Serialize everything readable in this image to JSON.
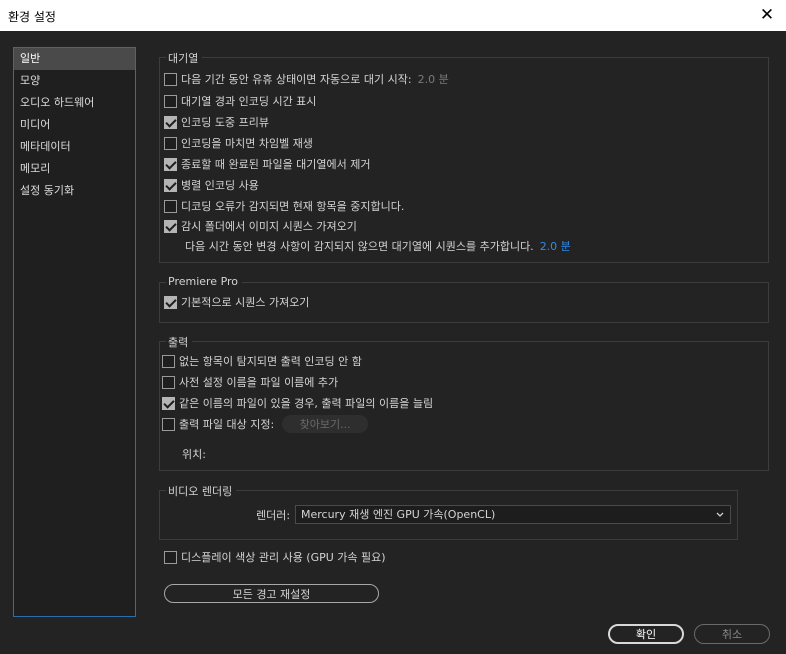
{
  "window": {
    "title": "환경 설정",
    "close_glyph": "✕"
  },
  "sidebar": {
    "items": [
      {
        "label": "일반"
      },
      {
        "label": "모양"
      },
      {
        "label": "오디오 하드웨어"
      },
      {
        "label": "미디어"
      },
      {
        "label": "메타데이터"
      },
      {
        "label": "메모리"
      },
      {
        "label": "설정 동기화"
      }
    ]
  },
  "queue": {
    "title": "대기열",
    "options": [
      {
        "label": "다음 기간 동안 유휴 상태이면 자동으로 대기 시작:",
        "checked": false,
        "suffix": "2.0 분"
      },
      {
        "label": "대기열 경과 인코딩 시간 표시",
        "checked": false
      },
      {
        "label": "인코딩 도중 프리뷰",
        "checked": true
      },
      {
        "label": "인코딩을 마치면 차임벨 재생",
        "checked": false
      },
      {
        "label": "종료할 때 완료된 파일을 대기열에서 제거",
        "checked": true
      },
      {
        "label": "병렬 인코딩 사용",
        "checked": true
      },
      {
        "label": "디코딩 오류가 감지되면 현재 항목을 중지합니다.",
        "checked": false
      },
      {
        "label": "감시 폴더에서 이미지 시퀀스 가져오기",
        "checked": true
      }
    ],
    "sub_text": "다음 시간 동안 변경 사항이 감지되지 않으면 대기열에 시퀀스를 추가합니다.",
    "sub_value": "2.0 분"
  },
  "premiere": {
    "title": "Premiere Pro",
    "options": [
      {
        "label": "기본적으로 시퀀스 가져오기",
        "checked": true
      }
    ]
  },
  "output": {
    "title": "출력",
    "options": [
      {
        "label": "없는 항목이 탐지되면 출력 인코딩 안 함",
        "checked": false
      },
      {
        "label": "사전 설정 이름을 파일 이름에 추가",
        "checked": false
      },
      {
        "label": "같은 이름의 파일이 있을 경우, 출력 파일의 이름을 늘림",
        "checked": true
      },
      {
        "label": "출력 파일 대상 지정:",
        "checked": false
      }
    ],
    "browse_label": "찾아보기...",
    "location_label": "위치:"
  },
  "video": {
    "title": "비디오 렌더링",
    "renderer_label": "렌더러:",
    "renderer_value": "Mercury 재생 엔진 GPU 가속(OpenCL)"
  },
  "display_color": {
    "label": "디스플레이 색상 관리 사용 (GPU 가속 필요)",
    "checked": false
  },
  "reset_label": "모든 경고 재설정",
  "footer": {
    "ok_label": "확인",
    "cancel_label": "취소"
  }
}
